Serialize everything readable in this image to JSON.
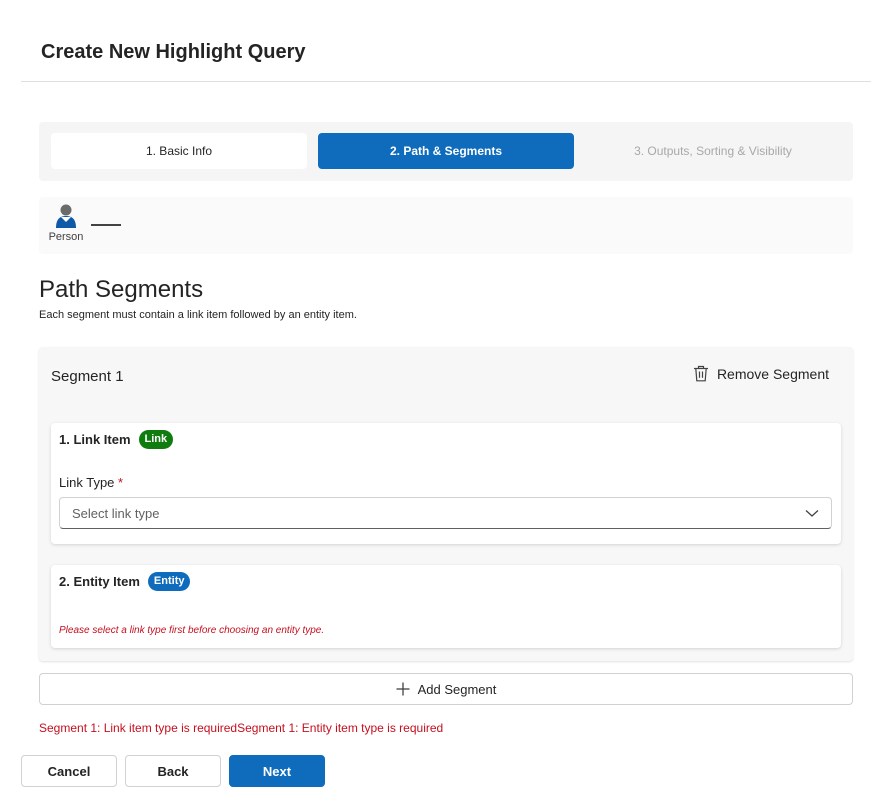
{
  "page": {
    "title": "Create New Highlight Query"
  },
  "stepper": {
    "steps": [
      {
        "label": "1. Basic Info",
        "state": "completed"
      },
      {
        "label": "2. Path & Segments",
        "state": "active"
      },
      {
        "label": "3. Outputs, Sorting & Visibility",
        "state": "disabled"
      }
    ]
  },
  "path_preview": {
    "node_label": "Person",
    "node_icon": "person-icon"
  },
  "section": {
    "title": "Path Segments",
    "description": "Each segment must contain a link item followed by an entity item."
  },
  "segment": {
    "title": "Segment 1",
    "remove_label": "Remove Segment",
    "remove_icon": "trash-icon",
    "link_item": {
      "title": "1. Link Item",
      "badge": "Link",
      "badge_color": "#107c10",
      "field_label": "Link Type",
      "required_marker": "*",
      "placeholder": "Select link type"
    },
    "entity_item": {
      "title": "2. Entity Item",
      "badge": "Entity",
      "badge_color": "#0f6cbd",
      "hint": "Please select a link type first before choosing an entity type."
    }
  },
  "add_segment_label": "Add Segment",
  "validation_error": "Segment 1: Link item type is requiredSegment 1: Entity item type is required",
  "footer": {
    "cancel_label": "Cancel",
    "back_label": "Back",
    "next_label": "Next"
  },
  "colors": {
    "primary": "#0f6cbd",
    "error": "#c50f1f",
    "success": "#107c10"
  }
}
